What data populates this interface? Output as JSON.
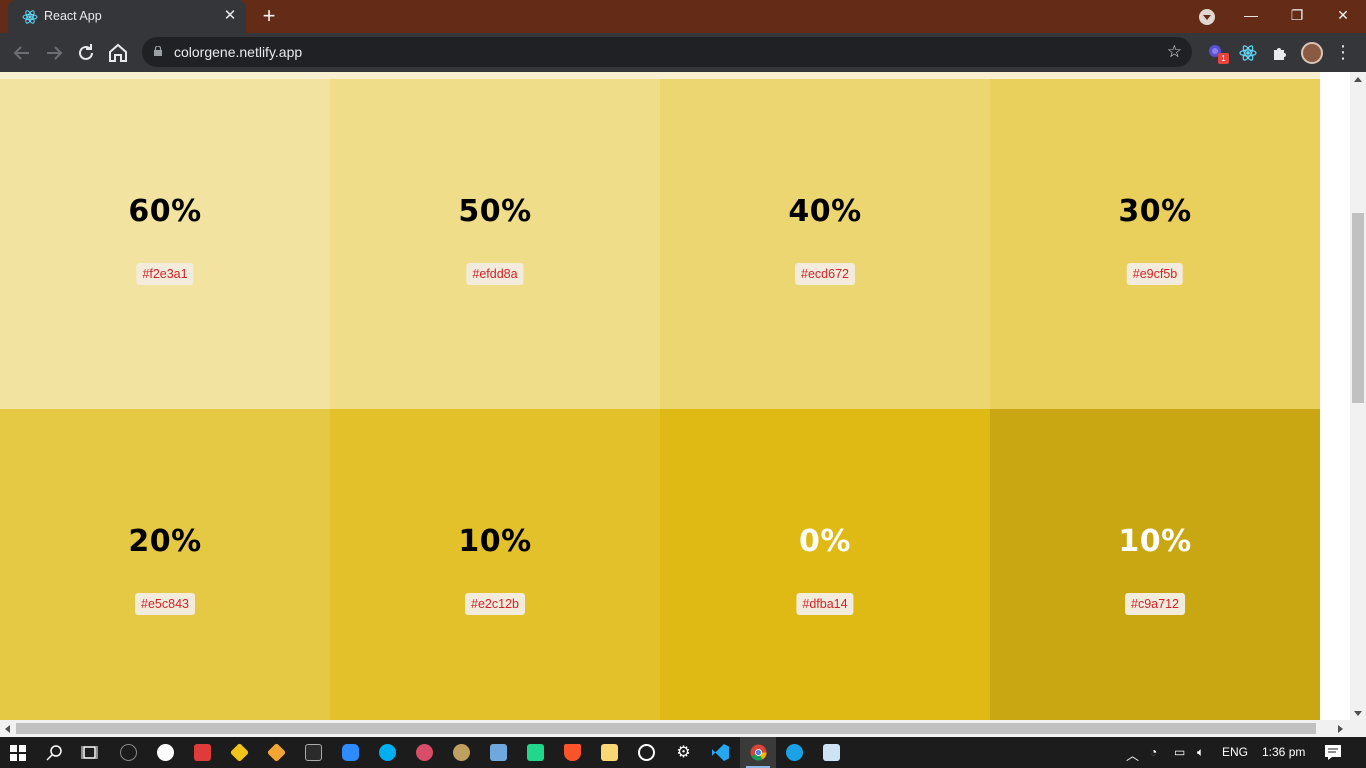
{
  "browser": {
    "tab_title": "React App",
    "tab_close": "✕",
    "new_tab": "+",
    "url": "colorgene.netlify.app",
    "back_icon": "arrow-left-icon",
    "forward_icon": "arrow-right-icon",
    "reload_icon": "reload-icon",
    "home_icon": "home-icon",
    "star_icon": "star-icon",
    "extension_badge": "1",
    "window_controls": {
      "minimize": "—",
      "maximize": "❐",
      "close": "✕"
    }
  },
  "palette": {
    "rows": [
      [
        {
          "percent": "60%",
          "hex": "#f2e3a1",
          "text_color": "#000000"
        },
        {
          "percent": "50%",
          "hex": "#efdd8a",
          "text_color": "#000000"
        },
        {
          "percent": "40%",
          "hex": "#ecd672",
          "text_color": "#000000"
        },
        {
          "percent": "30%",
          "hex": "#e9cf5b",
          "text_color": "#000000"
        }
      ],
      [
        {
          "percent": "20%",
          "hex": "#e5c843",
          "text_color": "#000000"
        },
        {
          "percent": "10%",
          "hex": "#e2c12b",
          "text_color": "#000000"
        },
        {
          "percent": "0%",
          "hex": "#dfba14",
          "text_color": "#ffffff"
        },
        {
          "percent": "10%",
          "hex": "#c9a712",
          "text_color": "#ffffff"
        }
      ]
    ]
  },
  "taskbar": {
    "language": "ENG",
    "time": "1:36 pm"
  }
}
